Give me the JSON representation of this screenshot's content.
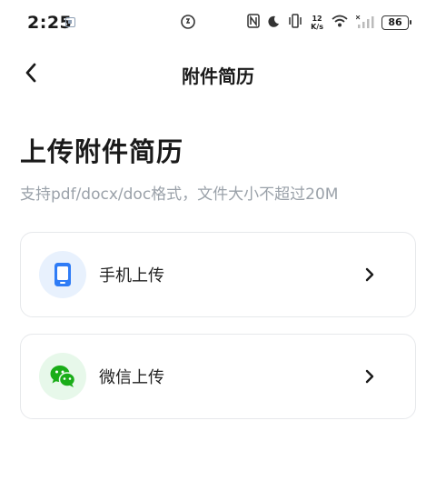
{
  "status_bar": {
    "time": "2:25",
    "speed_value": "12",
    "speed_unit": "K/s",
    "battery": "86"
  },
  "nav": {
    "title": "附件简历"
  },
  "page": {
    "heading": "上传附件简历",
    "subtitle": "支持pdf/docx/doc格式，文件大小不超过20M"
  },
  "options": [
    {
      "label": "手机上传",
      "icon": "phone-icon"
    },
    {
      "label": "微信上传",
      "icon": "wechat-icon"
    }
  ],
  "colors": {
    "phone_icon": "#2f7cf6",
    "wechat_icon": "#1aad19"
  }
}
